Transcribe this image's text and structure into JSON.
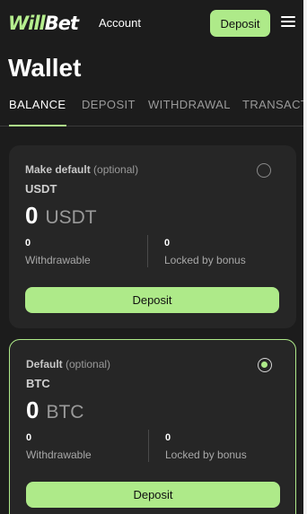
{
  "header": {
    "logo_will": "Will",
    "logo_bet": "Bet",
    "account_label": "Account",
    "deposit_label": "Deposit"
  },
  "page": {
    "title": "Wallet"
  },
  "tabs": [
    {
      "label": "BALANCE",
      "active": true
    },
    {
      "label": "DEPOSIT",
      "active": false
    },
    {
      "label": "WITHDRAWAL",
      "active": false
    },
    {
      "label": "TRANSACTI",
      "active": false
    }
  ],
  "cards": [
    {
      "hint_bold": "Make default",
      "hint_optional": "(optional)",
      "currency": "USDT",
      "amount": "0",
      "unit": "USDT",
      "withdrawable_value": "0",
      "withdrawable_label": "Withdrawable",
      "locked_value": "0",
      "locked_label": "Locked by bonus",
      "button_label": "Deposit",
      "selected": false
    },
    {
      "hint_bold": "Default",
      "hint_optional": "(optional)",
      "currency": "BTC",
      "amount": "0",
      "unit": "BTC",
      "withdrawable_value": "0",
      "withdrawable_label": "Withdrawable",
      "locked_value": "0",
      "locked_label": "Locked by bonus",
      "button_label": "Deposit",
      "selected": true
    }
  ],
  "colors": {
    "accent": "#aeea89",
    "background": "#1c1c1c",
    "card": "#262626"
  },
  "icons": {
    "menu": "hamburger-menu-icon",
    "radio": "radio-button-icon"
  }
}
